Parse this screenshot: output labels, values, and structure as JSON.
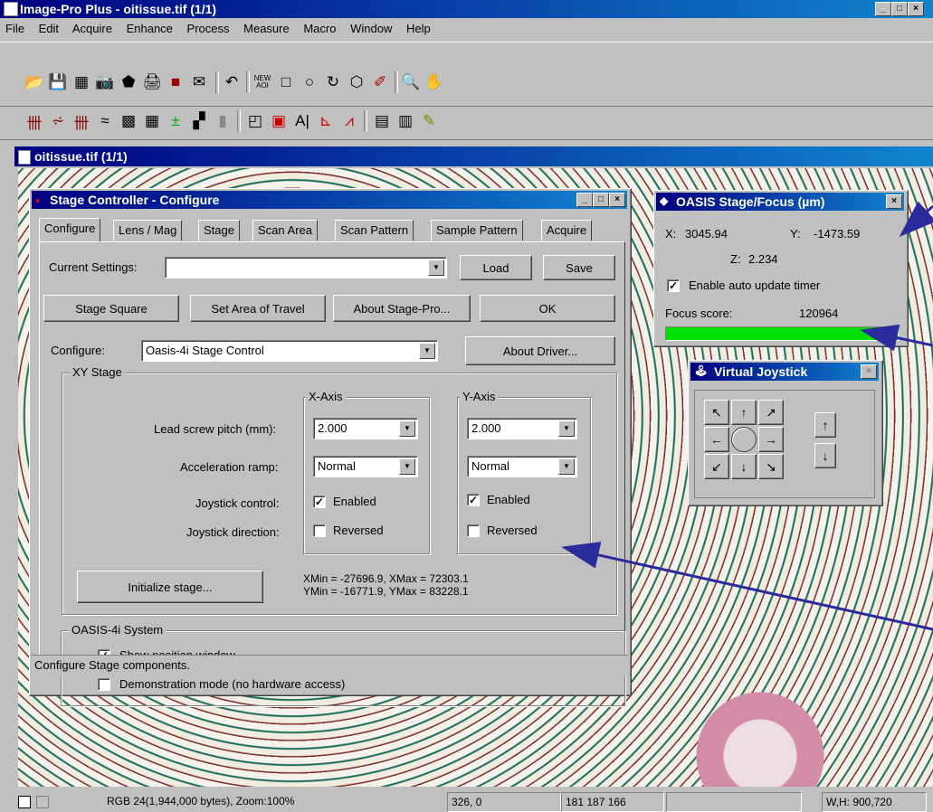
{
  "app": {
    "title": "Image-Pro Plus - oitissue.tif (1/1)"
  },
  "menu": [
    "File",
    "Edit",
    "Acquire",
    "Enhance",
    "Process",
    "Measure",
    "Macro",
    "Window",
    "Help"
  ],
  "toolbar1": [
    "open-icon",
    "save-icon",
    "grid-icon",
    "camera-icon",
    "eraser-icon",
    "print-icon",
    "book-icon",
    "mail-icon",
    "undo-icon",
    "new-aoi-icon",
    "rectangle-icon",
    "ellipse-icon",
    "freehand-icon",
    "irregular-icon",
    "wand-icon",
    "zoom-icon",
    "hand-icon"
  ],
  "toolbar1_new_aoi": "NEW\nAOI",
  "toolbar2": [
    "histogram-icon",
    "line-profile-icon",
    "bitmap-icon",
    "layers-icon",
    "filter-icon",
    "grid-pattern-icon",
    "threshold-icon",
    "color-icon",
    "gradient-icon",
    "bars-icon",
    "puzzle-icon",
    "channels-icon",
    "align-icon",
    "hist2-icon",
    "chart-icon",
    "report-icon",
    "book2-icon",
    "pencil-doc-icon"
  ],
  "doc": {
    "title": "oitissue.tif (1/1)"
  },
  "stage_dialog": {
    "title": "Stage Controller - Configure",
    "tabs": [
      "Configure",
      "Lens / Mag",
      "Stage",
      "Scan Area",
      "Scan Pattern",
      "Sample Pattern",
      "Acquire"
    ],
    "current_settings_label": "Current Settings:",
    "current_settings_value": "",
    "load": "Load",
    "save": "Save",
    "stage_square": "Stage Square",
    "set_area": "Set Area of Travel",
    "about_stage": "About Stage-Pro...",
    "ok": "OK",
    "configure_label": "Configure:",
    "configure_value": "Oasis-4i Stage Control",
    "about_driver": "About Driver...",
    "xy_group": "XY Stage",
    "x_axis": "X-Axis",
    "y_axis": "Y-Axis",
    "lead_label": "Lead screw pitch (mm):",
    "accel_label": "Acceleration ramp:",
    "joy_ctrl_label": "Joystick control:",
    "joy_dir_label": "Joystick direction:",
    "x_lead": "2.000",
    "y_lead": "2.000",
    "x_accel": "Normal",
    "y_accel": "Normal",
    "enabled": "Enabled",
    "reversed": "Reversed",
    "init": "Initialize stage...",
    "xrange": "XMin = -27696.9, XMax = 72303.1",
    "yrange": "YMin = -16771.9, YMax = 83228.1",
    "sys_group": "OASIS-4i System",
    "show_pos": "Show position window",
    "demo": "Demonstration mode (no hardware access)",
    "status": "Configure Stage components."
  },
  "oasis": {
    "title": "OASIS Stage/Focus (µm)",
    "x_label": "X:",
    "x": "3045.94",
    "y_label": "Y:",
    "y": "-1473.59",
    "z_label": "Z:",
    "z": "2.234",
    "timer": "Enable auto update timer",
    "focus_label": "Focus score:",
    "focus": "120964",
    "focus_level": 1.0
  },
  "joystick": {
    "title": "Virtual Joystick"
  },
  "statusbar": {
    "info": "RGB 24(1,944,000 bytes), Zoom:100%",
    "coords": "326,   0",
    "rgb": "181 187 166",
    "empty": "",
    "wh": "W,H: 900,720"
  },
  "colors": {
    "title_start": "#000080",
    "title_end": "#1084d0",
    "focus_bar": "#00e000",
    "arrow": "#2b2b9e"
  }
}
